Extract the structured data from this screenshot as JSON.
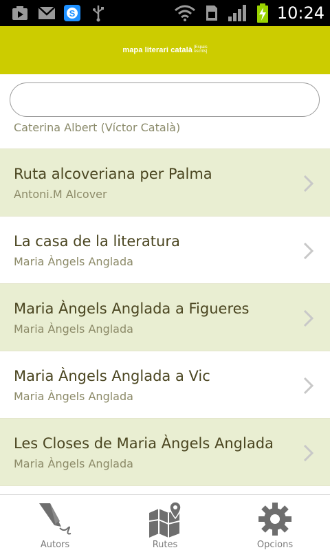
{
  "status_bar": {
    "time": "10:24",
    "icons": [
      "media-play-icon",
      "gmail-icon",
      "skype-icon",
      "usb-icon",
      "wifi-icon",
      "sim-card-icon",
      "signal-icon",
      "battery-charging-icon"
    ]
  },
  "header": {
    "logo_main": "mapa literari català",
    "logo_sub": "[Espais\nescrits]"
  },
  "search": {
    "value": "",
    "placeholder": ""
  },
  "list": {
    "partial_subtitle": "Caterina Albert (Víctor Català)",
    "items": [
      {
        "title": "Ruta alcoveriana per Palma",
        "subtitle": "Antoni.M Alcover"
      },
      {
        "title": "La casa de la literatura",
        "subtitle": "Maria Àngels Anglada"
      },
      {
        "title": "Maria Àngels Anglada a Figueres",
        "subtitle": "Maria Àngels Anglada"
      },
      {
        "title": "Maria Àngels Anglada a Vic",
        "subtitle": "Maria Àngels Anglada"
      },
      {
        "title": "Les Closes de Maria Àngels Anglada",
        "subtitle": "Maria Àngels Anglada"
      }
    ]
  },
  "bottom_nav": {
    "items": [
      {
        "label": "Autors",
        "icon": "quill-pen-icon"
      },
      {
        "label": "Rutes",
        "icon": "map-pin-icon"
      },
      {
        "label": "Opcions",
        "icon": "gear-icon"
      }
    ]
  },
  "colors": {
    "header": "#cccc00",
    "row_alt": "#e9eed2",
    "title_text": "#4a4520",
    "subtitle_text": "#8c8a68"
  }
}
